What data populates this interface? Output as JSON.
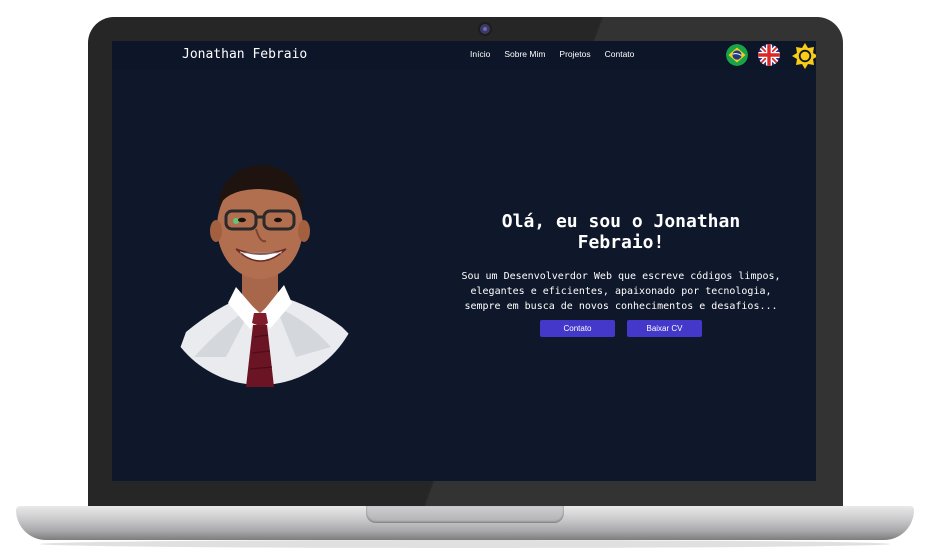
{
  "header": {
    "brand": "Jonathan Febraio",
    "nav": [
      "Início",
      "Sobre Mim",
      "Projetos",
      "Contato"
    ],
    "icons": [
      "brazil-flag-icon",
      "uk-flag-icon",
      "sun-icon"
    ]
  },
  "hero": {
    "title_line1": "Olá, eu sou o Jonathan",
    "title_line2": "Febraio!",
    "desc_line1": "Sou um Desenvolverdor Web que escreve códigos limpos,",
    "desc_line2": "elegantes e eficientes, apaixonado por tecnologia,",
    "desc_line3": "sempre em busca de novos conhecimentos e desafios...",
    "buttons": [
      "Contato",
      "Baixar CV"
    ]
  },
  "colors": {
    "background": "#0f172a",
    "header": "#0d1528",
    "accent": "#4338ca",
    "sun": "#facc15"
  }
}
